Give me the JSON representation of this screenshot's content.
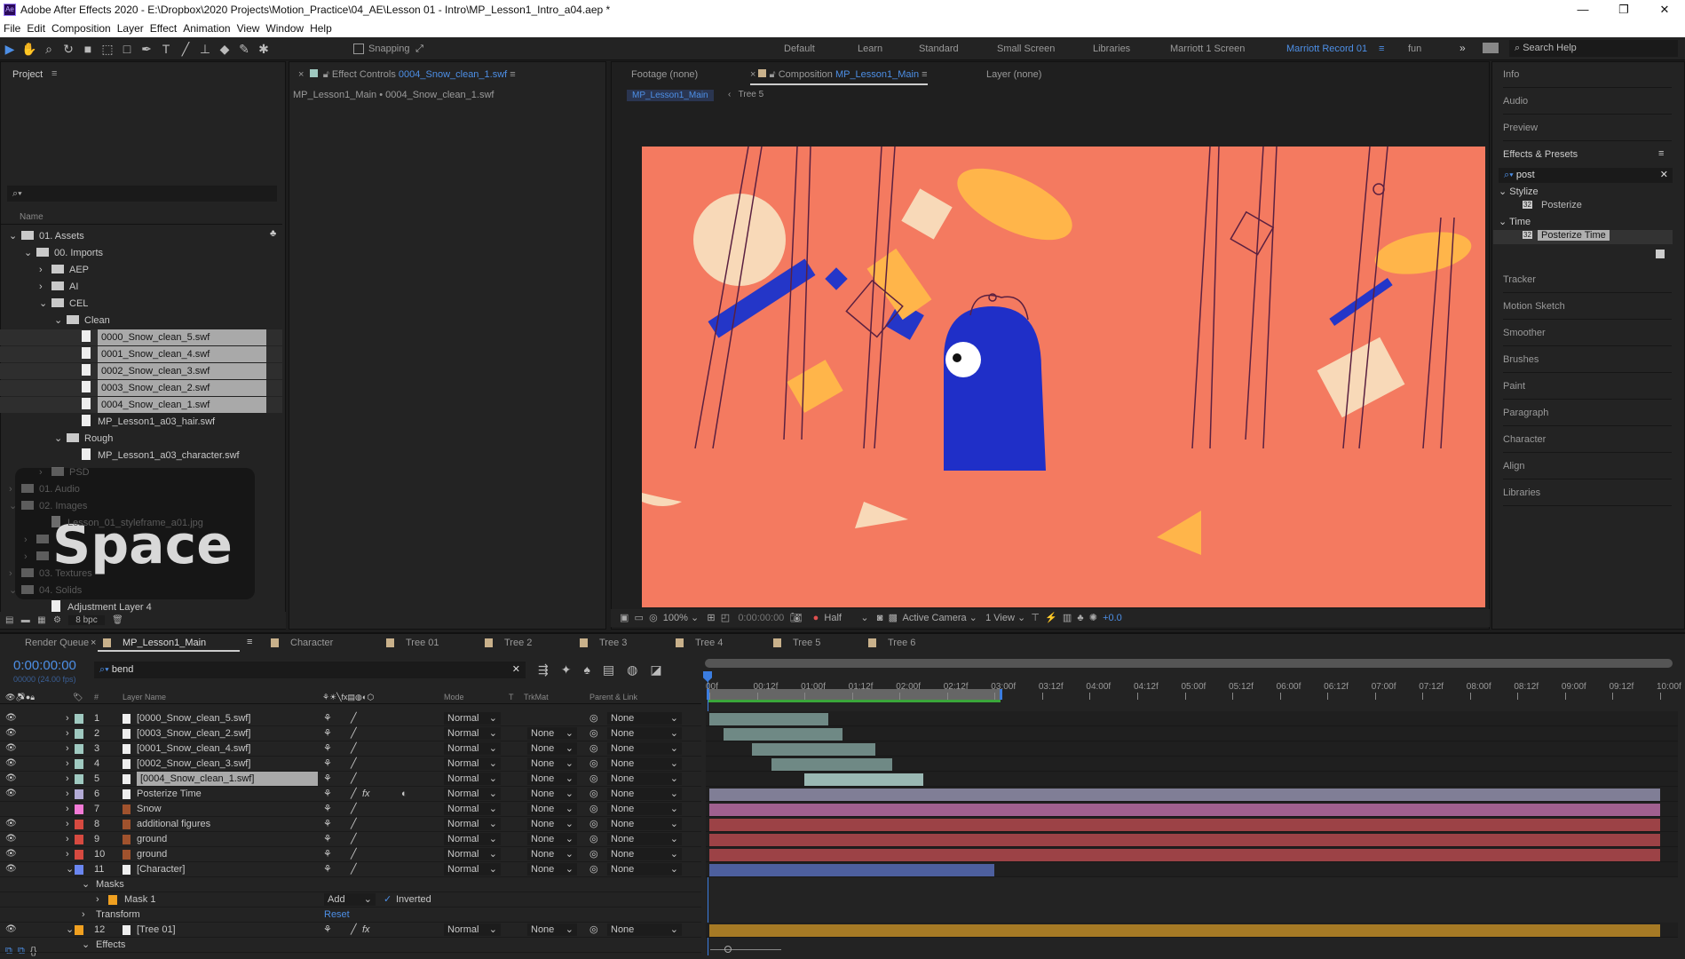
{
  "window": {
    "title": "Adobe After Effects 2020 - E:\\Dropbox\\2020 Projects\\Motion_Practice\\04_AE\\Lesson 01 - Intro\\MP_Lesson1_Intro_a04.aep *",
    "logo": "Ae"
  },
  "menu": [
    "File",
    "Edit",
    "Composition",
    "Layer",
    "Effect",
    "Animation",
    "View",
    "Window",
    "Help"
  ],
  "toolbar": {
    "snapping": "Snapping",
    "workspaces": [
      "Default",
      "Learn",
      "Standard",
      "Small Screen",
      "Libraries",
      "Marriott 1 Screen",
      "Marriott Record 01",
      "fun"
    ],
    "active_workspace": "Marriott Record 01",
    "search_help": "Search Help"
  },
  "project": {
    "tab": "Project",
    "name_col": "Name",
    "bpc": "8 bpc",
    "items": [
      {
        "label": "01. Assets",
        "type": "folder",
        "depth": 0,
        "open": true
      },
      {
        "label": "00. Imports",
        "type": "folder",
        "depth": 1,
        "open": true
      },
      {
        "label": "AEP",
        "type": "folder",
        "depth": 2,
        "open": false
      },
      {
        "label": "AI",
        "type": "folder",
        "depth": 2,
        "open": false
      },
      {
        "label": "CEL",
        "type": "folder",
        "depth": 2,
        "open": true
      },
      {
        "label": "Clean",
        "type": "folder",
        "depth": 3,
        "open": true
      },
      {
        "label": "0000_Snow_clean_5.swf",
        "type": "file",
        "depth": 4,
        "selected": true
      },
      {
        "label": "0001_Snow_clean_4.swf",
        "type": "file",
        "depth": 4,
        "selected": true
      },
      {
        "label": "0002_Snow_clean_3.swf",
        "type": "file",
        "depth": 4,
        "selected": true
      },
      {
        "label": "0003_Snow_clean_2.swf",
        "type": "file",
        "depth": 4,
        "selected": true
      },
      {
        "label": "0004_Snow_clean_1.swf",
        "type": "file",
        "depth": 4,
        "selected": true
      },
      {
        "label": "MP_Lesson1_a03_hair.swf",
        "type": "file",
        "depth": 4
      },
      {
        "label": "Rough",
        "type": "folder",
        "depth": 3,
        "open": true
      },
      {
        "label": "MP_Lesson1_a03_character.swf",
        "type": "file",
        "depth": 4
      },
      {
        "label": "PSD",
        "type": "folder",
        "depth": 2,
        "open": false,
        "dim": true
      },
      {
        "label": "01. Audio",
        "type": "folder",
        "depth": 0,
        "open": false,
        "dim": true
      },
      {
        "label": "02. Images",
        "type": "folder",
        "depth": 0,
        "open": true,
        "dim": true
      },
      {
        "label": "Lesson_01_styleframe_a01.jpg",
        "type": "file",
        "depth": 2,
        "dim": true
      },
      {
        "label": "",
        "type": "folder",
        "depth": 1,
        "dim": true
      },
      {
        "label": "",
        "type": "folder",
        "depth": 1,
        "dim": true
      },
      {
        "label": "03. Textures",
        "type": "folder",
        "depth": 0,
        "dim": true
      },
      {
        "label": "04. Solids",
        "type": "folder",
        "depth": 0,
        "open": true,
        "dim": true
      },
      {
        "label": "Adjustment Layer 4",
        "type": "file",
        "depth": 2
      }
    ]
  },
  "overlay_key": "Space",
  "effect_controls": {
    "tab_prefix": "Effect Controls",
    "tab_layer": "0004_Snow_clean_1.swf",
    "breadcrumb": "MP_Lesson1_Main • 0004_Snow_clean_1.swf"
  },
  "viewer": {
    "footage_tab": "Footage (none)",
    "comp_prefix": "Composition",
    "comp_name": "MP_Lesson1_Main",
    "layer_tab": "Layer (none)",
    "crumb_main": "MP_Lesson1_Main",
    "crumb_sub": "Tree 5",
    "zoom": "100%",
    "timecode": "0:00:00:00",
    "resolution": "Half",
    "camera": "Active Camera",
    "views": "1 View",
    "exposure": "+0.0",
    "bg_color": "#f47a60"
  },
  "right_panel": {
    "items_top": [
      "Info",
      "Audio",
      "Preview"
    ],
    "effects_title": "Effects & Presets",
    "search": "post",
    "groups": [
      {
        "name": "Stylize",
        "items": [
          "Posterize"
        ]
      },
      {
        "name": "Time",
        "items": [
          "Posterize Time"
        ]
      }
    ],
    "selected_effect": "Posterize Time",
    "items_bottom": [
      "Tracker",
      "Motion Sketch",
      "Smoother",
      "Brushes",
      "Paint",
      "Paragraph",
      "Character",
      "Align",
      "Libraries"
    ]
  },
  "timeline": {
    "tabs": [
      "Render Queue",
      "MP_Lesson1_Main",
      "Character",
      "Tree 01",
      "Tree 2",
      "Tree 3",
      "Tree 4",
      "Tree 5",
      "Tree 6"
    ],
    "active_tab": "MP_Lesson1_Main",
    "timecode": "0:00:00:00",
    "fps": "00000 (24.00 fps)",
    "search": "bend",
    "columns": {
      "name": "Layer Name",
      "mode": "Mode",
      "t": "T",
      "trkmat": "TrkMat",
      "parent": "Parent & Link",
      "num": "#"
    },
    "ruler": [
      "00f",
      "00:12f",
      "01:00f",
      "01:12f",
      "02:00f",
      "02:12f",
      "03:00f",
      "03:12f",
      "04:00f",
      "04:12f",
      "05:00f",
      "05:12f",
      "06:00f",
      "06:12f",
      "07:00f",
      "07:12f",
      "08:00f",
      "08:12f",
      "09:00f",
      "09:12f",
      "10:00f"
    ],
    "work_area_end": "03:00f",
    "layers": [
      {
        "num": "1",
        "name": "[0000_Snow_clean_5.swf]",
        "label_color": "#9fc9c0",
        "mode": "Normal",
        "trkmat": "",
        "parent": "None",
        "fx": false,
        "visible": true,
        "bar": [
          "00f",
          "01:00f+12"
        ],
        "bar_color": "#6f8985"
      },
      {
        "num": "2",
        "name": "[0003_Snow_clean_2.swf]",
        "label_color": "#9fc9c0",
        "mode": "Normal",
        "trkmat": "None",
        "parent": "None",
        "visible": true,
        "bar_color": "#6f8985"
      },
      {
        "num": "3",
        "name": "[0001_Snow_clean_4.swf]",
        "label_color": "#9fc9c0",
        "mode": "Normal",
        "trkmat": "None",
        "parent": "None",
        "visible": true,
        "bar_color": "#6f8985"
      },
      {
        "num": "4",
        "name": "[0002_Snow_clean_3.swf]",
        "label_color": "#9fc9c0",
        "mode": "Normal",
        "trkmat": "None",
        "parent": "None",
        "visible": true,
        "bar_color": "#6f8985"
      },
      {
        "num": "5",
        "name": "[0004_Snow_clean_1.swf]",
        "label_color": "#9fc9c0",
        "mode": "Normal",
        "trkmat": "None",
        "parent": "None",
        "visible": true,
        "selected": true,
        "bar_color": "#9ab8b3"
      },
      {
        "num": "6",
        "name": "Posterize Time",
        "label_color": "#b3abd6",
        "mode": "Normal",
        "trkmat": "None",
        "parent": "None",
        "fx": true,
        "visible": true,
        "bar_color": "#807e96"
      },
      {
        "num": "7",
        "name": "Snow",
        "label_color": "#f27ad6",
        "mode": "Normal",
        "trkmat": "None",
        "parent": "None",
        "visible": false,
        "bar_color": "#a0608f"
      },
      {
        "num": "8",
        "name": "additional figures",
        "label_color": "#d64a40",
        "mode": "Normal",
        "trkmat": "None",
        "parent": "None",
        "visible": true,
        "bar_color": "#9c4246"
      },
      {
        "num": "9",
        "name": "ground",
        "label_color": "#d64a40",
        "mode": "Normal",
        "trkmat": "None",
        "parent": "None",
        "visible": true,
        "bar_color": "#9c4246"
      },
      {
        "num": "10",
        "name": "ground",
        "label_color": "#d64a40",
        "mode": "Normal",
        "trkmat": "None",
        "parent": "None",
        "visible": true,
        "bar_color": "#9c4246"
      },
      {
        "num": "11",
        "name": "[Character]",
        "label_color": "#6a86f0",
        "mode": "Normal",
        "trkmat": "None",
        "parent": "None",
        "visible": true,
        "open": true,
        "bar_color": "#4d5f9e"
      },
      {
        "num": "12",
        "name": "[Tree 01]",
        "label_color": "#f0a020",
        "mode": "Normal",
        "trkmat": "None",
        "parent": "None",
        "fx": true,
        "visible": true,
        "open": true,
        "bar_color": "#a67a25"
      }
    ],
    "masks_label": "Masks",
    "mask": {
      "name": "Mask 1",
      "mode": "Add",
      "inverted_label": "Inverted",
      "inverted": true
    },
    "transform_label": "Transform",
    "reset_label": "Reset",
    "effects_label": "Effects"
  }
}
